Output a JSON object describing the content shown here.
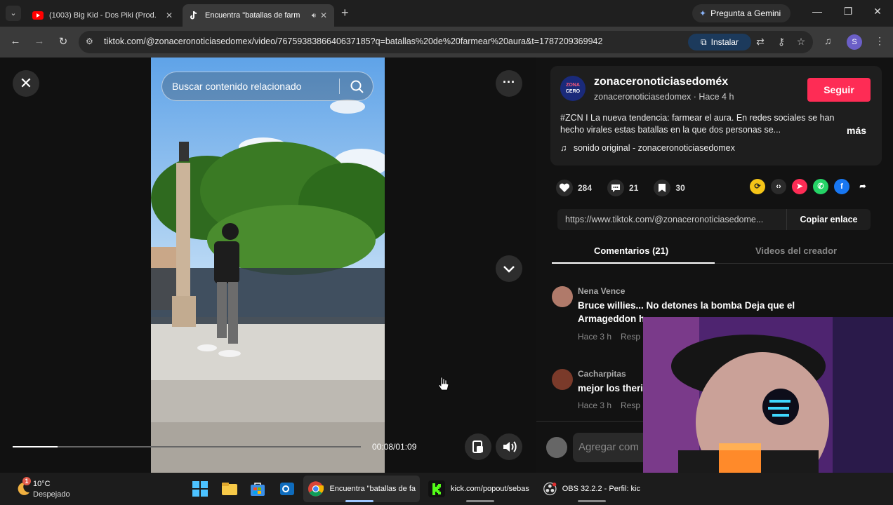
{
  "browser": {
    "tabs": [
      {
        "label": "(1003) Big Kid - Dos Piki (Prod.",
        "icon": "youtube-icon"
      },
      {
        "label": "Encuentra \"batallas de farm",
        "icon": "tiktok-icon"
      }
    ],
    "gemini_label": "Pregunta a Gemini",
    "url": "tiktok.com/@zonaceronoticiasedomex/video/7675938386640637185?q=batallas%20de%20farmear%20aura&t=1787209369942",
    "install_label": "Instalar",
    "profile_initial": "S"
  },
  "player": {
    "search_placeholder": "Buscar contenido relacionado",
    "time": "00:08/01:09",
    "progress": 0.13
  },
  "post": {
    "avatar_text": [
      "ZONA",
      "CERO"
    ],
    "author": "zonaceronoticiasedoméx",
    "subline": "zonaceronoticiasedomex · Hace 4 h",
    "follow_label": "Seguir",
    "caption": "#ZCN I La nueva tendencia: farmear el aura. En redes sociales se han hecho virales estas batallas en la que dos personas se...",
    "more_label": "más",
    "sound": "sonido original - zonaceronoticiasedomex",
    "likes": "284",
    "comments": "21",
    "saves": "30",
    "link": "https://www.tiktok.com/@zonaceronoticiasedome...",
    "copy_label": "Copiar enlace"
  },
  "panel_tabs": {
    "comments": "Comentarios (21)",
    "creator_videos": "Videos del creador"
  },
  "comments": [
    {
      "user": "Nena Vence",
      "text": "Bruce willies... No detones la bomba Deja que el Armageddon h",
      "time": "Hace 3 h",
      "reply": "Resp"
    },
    {
      "user": "Cacharpitas",
      "text": "mejor los theri",
      "time": "Hace 3 h",
      "reply": "Resp"
    }
  ],
  "comment_input_placeholder": "Agregar com",
  "taskbar": {
    "temp": "10°C",
    "weather": "Despejado",
    "weather_badge": "1",
    "chrome_label": "Encuentra \"batallas de fa",
    "kick_label": "kick.com/popout/sebas",
    "obs_label": "OBS 32.2.2 - Perfil: kic"
  },
  "colors": {
    "accent_follow": "#fe2c55",
    "install_bg": "#1c3a5c"
  }
}
